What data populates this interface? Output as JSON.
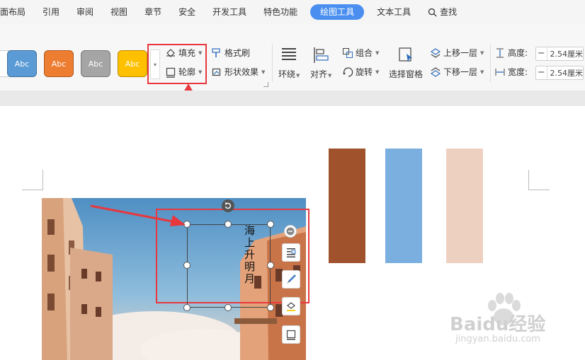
{
  "tabs": {
    "layout": "面布局",
    "reference": "引用",
    "review": "审阅",
    "view": "视图",
    "section": "章节",
    "security": "安全",
    "dev_tools": "开发工具",
    "special": "特色功能",
    "drawing_tools": "绘图工具",
    "text_tools": "文本工具",
    "search": "查找"
  },
  "shape_styles": [
    "Abc",
    "Abc",
    "Abc",
    "Abc",
    "Abc"
  ],
  "shape_style_colors": [
    "#ffffff",
    "#5b9bd5",
    "#ed7d31",
    "#a5a5a5",
    "#ffc000"
  ],
  "ribbon": {
    "fill": "填充",
    "outline": "轮廓",
    "format_painter": "格式刷",
    "shape_effects": "形状效果",
    "wrap": "环绕",
    "align": "对齐",
    "group": "组合",
    "rotate": "旋转",
    "selection_pane": "选择窗格",
    "bring_forward": "上移一层",
    "send_backward": "下移一层",
    "height_label": "高度:",
    "height_value": "2.54厘米",
    "width_label": "宽度:",
    "width_value": "2.54厘米"
  },
  "textbox_text": "海上升明月",
  "color_swatches": [
    "#a0522d",
    "#7aafe0",
    "#eed0c0"
  ],
  "watermark": {
    "logo": "Baidu经验",
    "url": "jingyan.baidu.com"
  },
  "colors": {
    "accent": "#4a8ff0",
    "highlight_red": "#e8383d"
  }
}
